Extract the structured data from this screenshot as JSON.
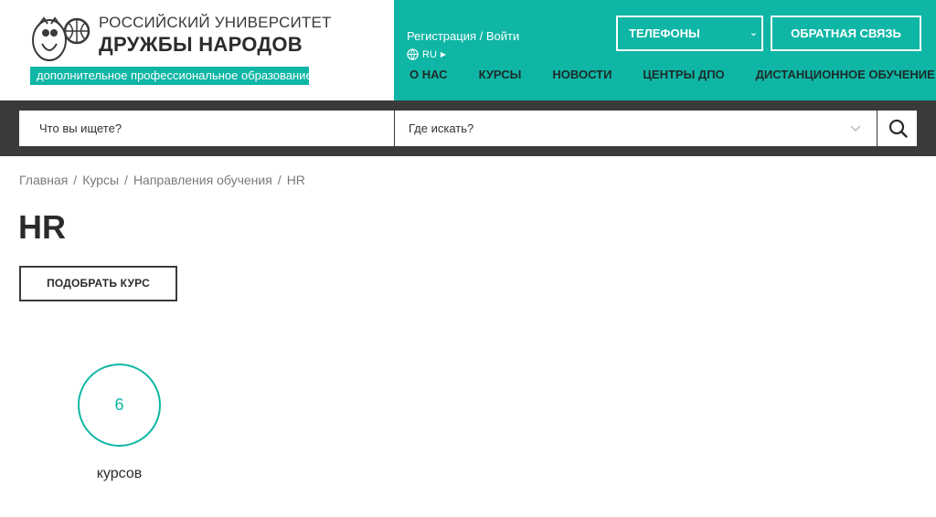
{
  "header": {
    "logo": {
      "line1": "РОССИЙСКИЙ УНИВЕРСИТЕТ",
      "line2": "ДРУЖБЫ НАРОДОВ",
      "subtitle": "дополнительное профессиональное образование"
    },
    "login_link": "Регистрация / Войти",
    "language": "RU",
    "phones_label": "ТЕЛЕФОНЫ",
    "feedback_label": "ОБРАТНАЯ СВЯЗЬ",
    "nav": [
      {
        "label": "О НАС"
      },
      {
        "label": "КУРСЫ"
      },
      {
        "label": "НОВОСТИ"
      },
      {
        "label": "ЦЕНТРЫ ДПО"
      },
      {
        "label": "ДИСТАНЦИОННОЕ ОБУЧЕНИЕ"
      }
    ],
    "colors": {
      "accent": "#0fb6a5",
      "dark": "#3a3a3a"
    }
  },
  "search": {
    "what_placeholder": "Что вы ищете?",
    "where_placeholder": "Где искать?",
    "button_icon": "search-icon"
  },
  "breadcrumb": [
    "Главная",
    "Курсы",
    "Направления обучения",
    "HR"
  ],
  "page": {
    "title": "HR",
    "pick_button": "ПОДОБРАТЬ КУРС",
    "course_count": "6",
    "course_count_label": "курсов"
  }
}
